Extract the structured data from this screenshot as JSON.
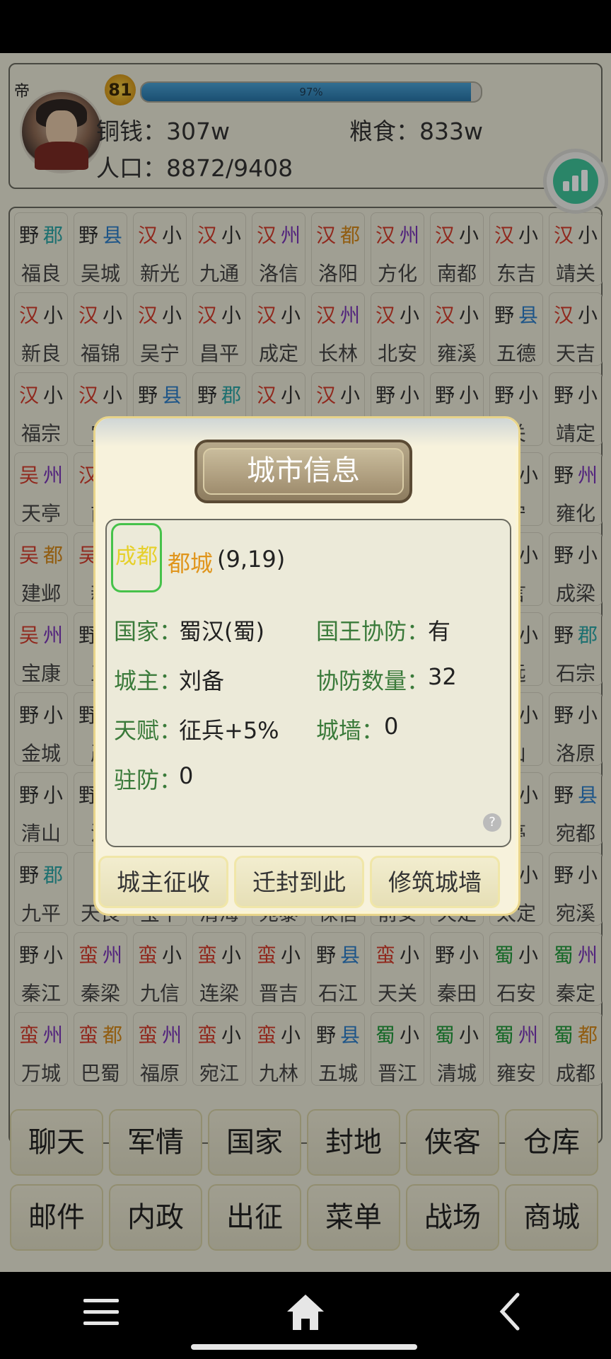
{
  "player": {
    "level": "81",
    "exp_percent_label": "97%",
    "exp_percent": 97,
    "copper_label": "铜钱：",
    "copper_value": "307w",
    "grain_label": "粮食：",
    "grain_value": "833w",
    "population_label": "人口：",
    "population_value": "8872/9408",
    "crown_glyph": "帝"
  },
  "grid": {
    "rows": [
      [
        [
          "野",
          "郡",
          "福良"
        ],
        [
          "野",
          "县",
          "吴城"
        ],
        [
          "汉",
          "小",
          "新光"
        ],
        [
          "汉",
          "小",
          "九通"
        ],
        [
          "汉",
          "州",
          "洛信"
        ],
        [
          "汉",
          "都",
          "洛阳"
        ],
        [
          "汉",
          "州",
          "方化"
        ],
        [
          "汉",
          "小",
          "南都"
        ],
        [
          "汉",
          "小",
          "东吉"
        ],
        [
          "汉",
          "小",
          "靖关"
        ]
      ],
      [
        [
          "汉",
          "小",
          "新良"
        ],
        [
          "汉",
          "小",
          "福锦"
        ],
        [
          "汉",
          "小",
          "吴宁"
        ],
        [
          "汉",
          "小",
          "昌平"
        ],
        [
          "汉",
          "小",
          "成定"
        ],
        [
          "汉",
          "州",
          "长林"
        ],
        [
          "汉",
          "小",
          "北安"
        ],
        [
          "汉",
          "小",
          "雍溪"
        ],
        [
          "野",
          "县",
          "五德"
        ],
        [
          "汉",
          "小",
          "天吉"
        ]
      ],
      [
        [
          "汉",
          "小",
          "福宗"
        ],
        [
          "汉",
          "小",
          "宝"
        ],
        [
          "野",
          "县",
          ""
        ],
        [
          "野",
          "郡",
          ""
        ],
        [
          "汉",
          "小",
          ""
        ],
        [
          "汉",
          "小",
          ""
        ],
        [
          "野",
          "小",
          ""
        ],
        [
          "野",
          "小",
          ""
        ],
        [
          "野",
          "小",
          "关"
        ],
        [
          "野",
          "小",
          "靖定"
        ]
      ],
      [
        [
          "吴",
          "州",
          "天亭"
        ],
        [
          "汉",
          "",
          "前"
        ],
        [
          "",
          "",
          ""
        ],
        [
          "",
          "",
          ""
        ],
        [
          "",
          "",
          ""
        ],
        [
          "",
          "",
          ""
        ],
        [
          "",
          "",
          ""
        ],
        [
          "",
          "",
          ""
        ],
        [
          "",
          "小",
          "宁"
        ],
        [
          "野",
          "州",
          "雍化"
        ]
      ],
      [
        [
          "吴",
          "都",
          "建邺"
        ],
        [
          "吴",
          "",
          "新"
        ],
        [
          "",
          "",
          ""
        ],
        [
          "",
          "",
          ""
        ],
        [
          "",
          "",
          ""
        ],
        [
          "",
          "",
          ""
        ],
        [
          "",
          "",
          ""
        ],
        [
          "",
          "",
          ""
        ],
        [
          "",
          "小",
          "言"
        ],
        [
          "野",
          "小",
          "成梁"
        ]
      ],
      [
        [
          "吴",
          "州",
          "宝康"
        ],
        [
          "野",
          "",
          "五"
        ],
        [
          "",
          "",
          ""
        ],
        [
          "",
          "",
          ""
        ],
        [
          "",
          "",
          ""
        ],
        [
          "",
          "",
          ""
        ],
        [
          "",
          "",
          ""
        ],
        [
          "",
          "",
          ""
        ],
        [
          "",
          "小",
          "远"
        ],
        [
          "野",
          "郡",
          "石宗"
        ]
      ],
      [
        [
          "野",
          "小",
          "金城"
        ],
        [
          "野",
          "",
          "严"
        ],
        [
          "",
          "",
          ""
        ],
        [
          "",
          "",
          ""
        ],
        [
          "",
          "",
          ""
        ],
        [
          "",
          "",
          ""
        ],
        [
          "",
          "",
          ""
        ],
        [
          "",
          "",
          ""
        ],
        [
          "",
          "小",
          "山"
        ],
        [
          "野",
          "小",
          "洛原"
        ]
      ],
      [
        [
          "野",
          "小",
          "清山"
        ],
        [
          "野",
          "",
          "汪"
        ],
        [
          "",
          "",
          ""
        ],
        [
          "",
          "",
          ""
        ],
        [
          "",
          "",
          ""
        ],
        [
          "",
          "",
          ""
        ],
        [
          "",
          "",
          ""
        ],
        [
          "",
          "",
          ""
        ],
        [
          "",
          "小",
          "亭"
        ],
        [
          "野",
          "县",
          "宛都"
        ]
      ],
      [
        [
          "野",
          "郡",
          "九平"
        ],
        [
          "",
          "",
          "天良"
        ],
        [
          "",
          "",
          "宝平"
        ],
        [
          "",
          "",
          "清海"
        ],
        [
          "",
          "",
          "宛泰"
        ],
        [
          "",
          "",
          "保信"
        ],
        [
          "",
          "",
          "前安"
        ],
        [
          "",
          "",
          "天定"
        ],
        [
          "",
          "小",
          "太定"
        ],
        [
          "野",
          "小",
          "宛溪"
        ]
      ],
      [
        [
          "野",
          "小",
          "秦江"
        ],
        [
          "蛮",
          "州",
          "秦梁"
        ],
        [
          "蛮",
          "小",
          "九信"
        ],
        [
          "蛮",
          "小",
          "连梁"
        ],
        [
          "蛮",
          "小",
          "晋吉"
        ],
        [
          "野",
          "县",
          "石江"
        ],
        [
          "蛮",
          "小",
          "天关"
        ],
        [
          "野",
          "小",
          "秦田"
        ],
        [
          "蜀",
          "小",
          "石安"
        ],
        [
          "蜀",
          "州",
          "秦定"
        ]
      ],
      [
        [
          "蛮",
          "州",
          "万城"
        ],
        [
          "蛮",
          "都",
          "巴蜀"
        ],
        [
          "蛮",
          "州",
          "福原"
        ],
        [
          "蛮",
          "小",
          "宛江"
        ],
        [
          "蛮",
          "小",
          "九林"
        ],
        [
          "野",
          "县",
          "五城"
        ],
        [
          "蜀",
          "小",
          "晋江"
        ],
        [
          "蜀",
          "小",
          "清城"
        ],
        [
          "蜀",
          "州",
          "雍安"
        ],
        [
          "蜀",
          "都",
          "成都"
        ]
      ]
    ]
  },
  "menu": {
    "row1": [
      "聊天",
      "军情",
      "国家",
      "封地",
      "侠客",
      "仓库"
    ],
    "row2": [
      "邮件",
      "内政",
      "出征",
      "菜单",
      "战场",
      "商城"
    ]
  },
  "dialog": {
    "title": "城市信息",
    "city_name": "成都",
    "city_type": "都城",
    "city_coord": "(9,19)",
    "country_label": "国家：",
    "country_value": "蜀汉(蜀)",
    "king_defense_label": "国王协防：",
    "king_defense_value": "有",
    "lord_label": "城主：",
    "lord_value": "刘备",
    "defense_count_label": "协防数量：",
    "defense_count_value": "32",
    "talent_label": "天赋：",
    "talent_value": "征兵+5%",
    "wall_label": "城墙：",
    "wall_value": "0",
    "garrison_label": "驻防：",
    "garrison_value": "0",
    "buttons": [
      "城主征收",
      "迁封到此",
      "修筑城墙"
    ],
    "help_glyph": "?"
  },
  "colors": {
    "汉": "#d43b2b",
    "吴": "#d43b2b",
    "蛮": "#d43b2b",
    "蜀": "#1f9a3a",
    "野": "#333333",
    "郡": "#2aa6a6",
    "县": "#2a7dc9",
    "州": "#7a35b8",
    "都": "#d68a1a",
    "小": "#333333"
  }
}
